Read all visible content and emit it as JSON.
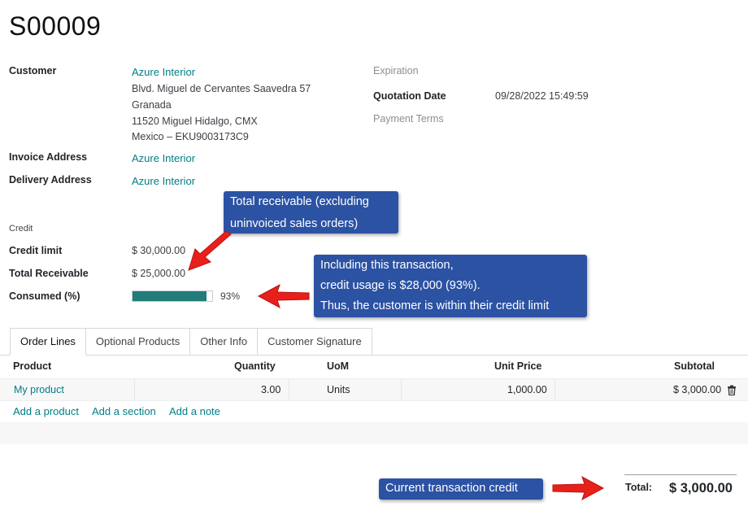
{
  "record": {
    "name": "S00009"
  },
  "customer": {
    "label": "Customer",
    "name": "Azure Interior",
    "address": [
      "Blvd. Miguel de Cervantes Saavedra 57",
      "Granada",
      "11520 Miguel Hidalgo, CMX",
      "Mexico – EKU9003173C9"
    ]
  },
  "invoice_address": {
    "label": "Invoice Address",
    "value": "Azure Interior"
  },
  "delivery_address": {
    "label": "Delivery Address",
    "value": "Azure Interior"
  },
  "right_fields": {
    "expiration_label": "Expiration",
    "quotation_date_label": "Quotation Date",
    "quotation_date_value": "09/28/2022 15:49:59",
    "payment_terms_label": "Payment Terms"
  },
  "credit": {
    "section_label": "Credit",
    "limit_label": "Credit limit",
    "limit_value": "$ 30,000.00",
    "receivable_label": "Total Receivable",
    "receivable_value": "$ 25,000.00",
    "consumed_label": "Consumed (%)",
    "consumed_percent": 93,
    "consumed_text": "93%"
  },
  "callouts": {
    "receivable_line1": "Total receivable (excluding",
    "receivable_line2": "uninvoiced sales orders)",
    "usage_line1": "Including this transaction,",
    "usage_line2": "credit usage is $28,000 (93%).",
    "usage_line3": "Thus, the customer is within their credit limit",
    "current": "Current transaction credit"
  },
  "tabs": [
    "Order Lines",
    "Optional Products",
    "Other Info",
    "Customer Signature"
  ],
  "table": {
    "headers": {
      "product": "Product",
      "quantity": "Quantity",
      "uom": "UoM",
      "unit_price": "Unit Price",
      "subtotal": "Subtotal"
    },
    "rows": [
      {
        "product": "My product",
        "quantity": "3.00",
        "uom": "Units",
        "unit_price": "1,000.00",
        "subtotal": "$ 3,000.00"
      }
    ],
    "add_product": "Add a product",
    "add_section": "Add a section",
    "add_note": "Add a note"
  },
  "totals": {
    "label": "Total:",
    "value": "$ 3,000.00"
  },
  "colors": {
    "accent": "#017e84",
    "progress": "#217c7a",
    "callout": "#2b52a3",
    "arrow": "#e8201a"
  },
  "icons": {
    "delete": "trash-icon"
  }
}
